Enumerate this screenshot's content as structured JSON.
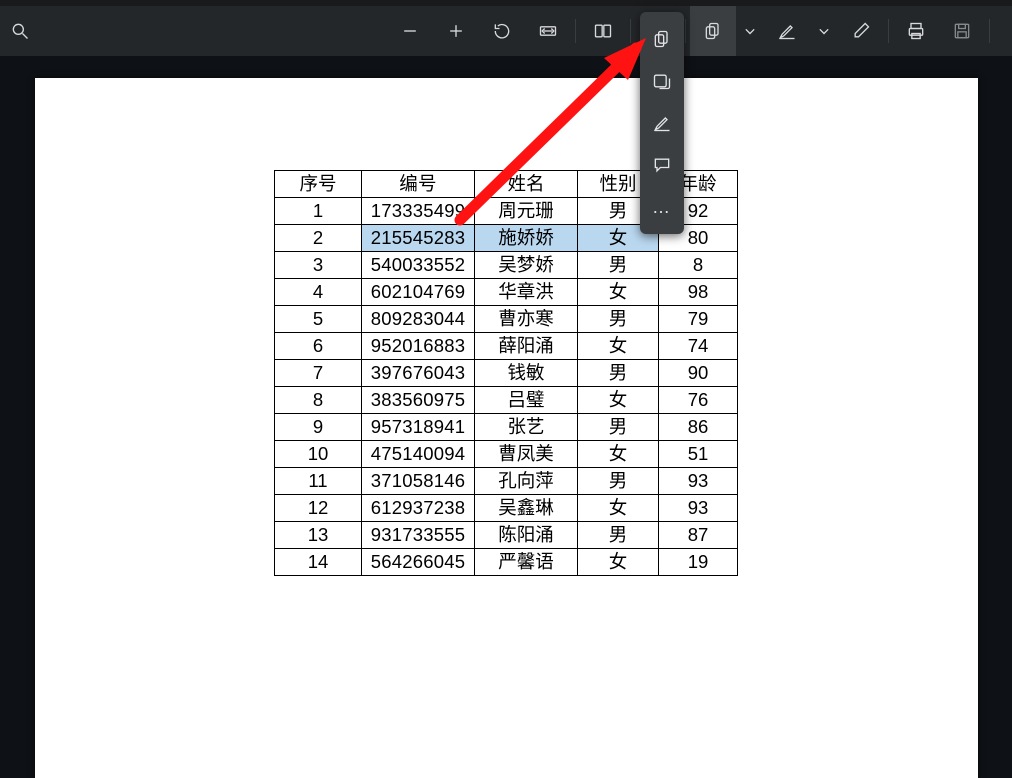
{
  "toolbar": {
    "icons": {
      "search": "search-icon",
      "minus": "minus-icon",
      "plus": "plus-icon",
      "lasso": "rotate-icon",
      "fit": "fit-width-icon",
      "page": "two-page-icon",
      "text": "text-annot-icon",
      "copy": "copy-icon",
      "chevron": "chevron-down-icon",
      "highlighter": "highlighter-icon",
      "eraser": "eraser-icon",
      "print": "print-icon",
      "save": "save-icon",
      "more_toolbar": "more-toolbar-icon"
    }
  },
  "dropdown": {
    "items": [
      {
        "name": "copy-icon"
      },
      {
        "name": "select-text-icon"
      },
      {
        "name": "highlight-icon"
      },
      {
        "name": "comment-icon"
      },
      {
        "name": "more-icon"
      }
    ]
  },
  "table": {
    "headers": [
      "序号",
      "编号",
      "姓名",
      "性别",
      "年龄"
    ],
    "selected_index": 1,
    "rows": [
      {
        "seq": "1",
        "id": "173335499",
        "name": "周元珊",
        "sex": "男",
        "age": "92"
      },
      {
        "seq": "2",
        "id": "215545283",
        "name": "施娇娇",
        "sex": "女",
        "age": "80"
      },
      {
        "seq": "3",
        "id": "540033552",
        "name": "吴梦娇",
        "sex": "男",
        "age": "8"
      },
      {
        "seq": "4",
        "id": "602104769",
        "name": "华章洪",
        "sex": "女",
        "age": "98"
      },
      {
        "seq": "5",
        "id": "809283044",
        "name": "曹亦寒",
        "sex": "男",
        "age": "79"
      },
      {
        "seq": "6",
        "id": "952016883",
        "name": "薛阳涌",
        "sex": "女",
        "age": "74"
      },
      {
        "seq": "7",
        "id": "397676043",
        "name": "钱敏",
        "sex": "男",
        "age": "90"
      },
      {
        "seq": "8",
        "id": "383560975",
        "name": "吕璧",
        "sex": "女",
        "age": "76"
      },
      {
        "seq": "9",
        "id": "957318941",
        "name": "张艺",
        "sex": "男",
        "age": "86"
      },
      {
        "seq": "10",
        "id": "475140094",
        "name": "曹凤美",
        "sex": "女",
        "age": "51"
      },
      {
        "seq": "11",
        "id": "371058146",
        "name": "孔向萍",
        "sex": "男",
        "age": "93"
      },
      {
        "seq": "12",
        "id": "612937238",
        "name": "吴鑫琳",
        "sex": "女",
        "age": "93"
      },
      {
        "seq": "13",
        "id": "931733555",
        "name": "陈阳涌",
        "sex": "男",
        "age": "87"
      },
      {
        "seq": "14",
        "id": "564266045",
        "name": "严馨语",
        "sex": "女",
        "age": "19"
      }
    ]
  },
  "annotation": {
    "kind": "red-arrow",
    "from_label": "document-area",
    "to_label": "copy-dropdown-item"
  }
}
